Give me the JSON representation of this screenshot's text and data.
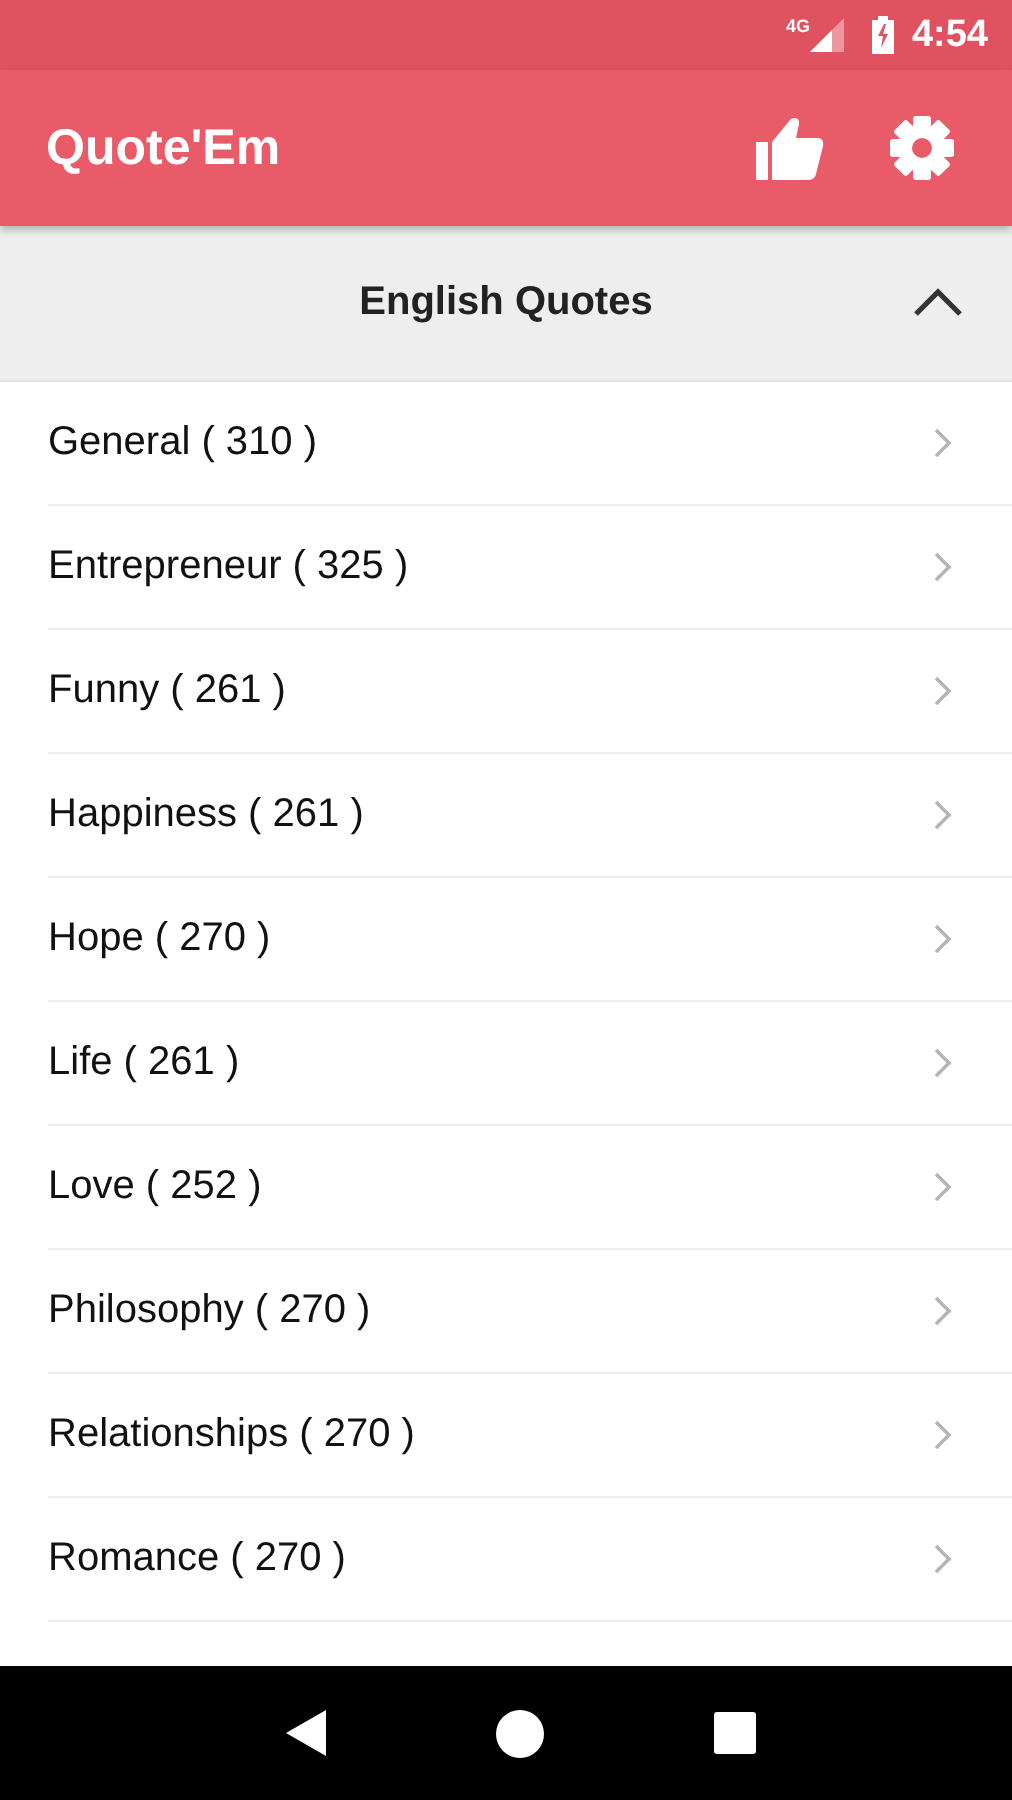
{
  "status_bar": {
    "network": "4G",
    "time": "4:54"
  },
  "app_bar": {
    "title": "Quote'Em"
  },
  "section": {
    "title": "English Quotes",
    "expanded": true
  },
  "categories": [
    {
      "label": "General ( 310 )"
    },
    {
      "label": "Entrepreneur ( 325 )"
    },
    {
      "label": "Funny ( 261 )"
    },
    {
      "label": "Happiness ( 261 )"
    },
    {
      "label": "Hope ( 270 )"
    },
    {
      "label": "Life ( 261 )"
    },
    {
      "label": "Love ( 252 )"
    },
    {
      "label": "Philosophy ( 270 )"
    },
    {
      "label": "Relationships ( 270 )"
    },
    {
      "label": "Romance ( 270 )"
    }
  ]
}
